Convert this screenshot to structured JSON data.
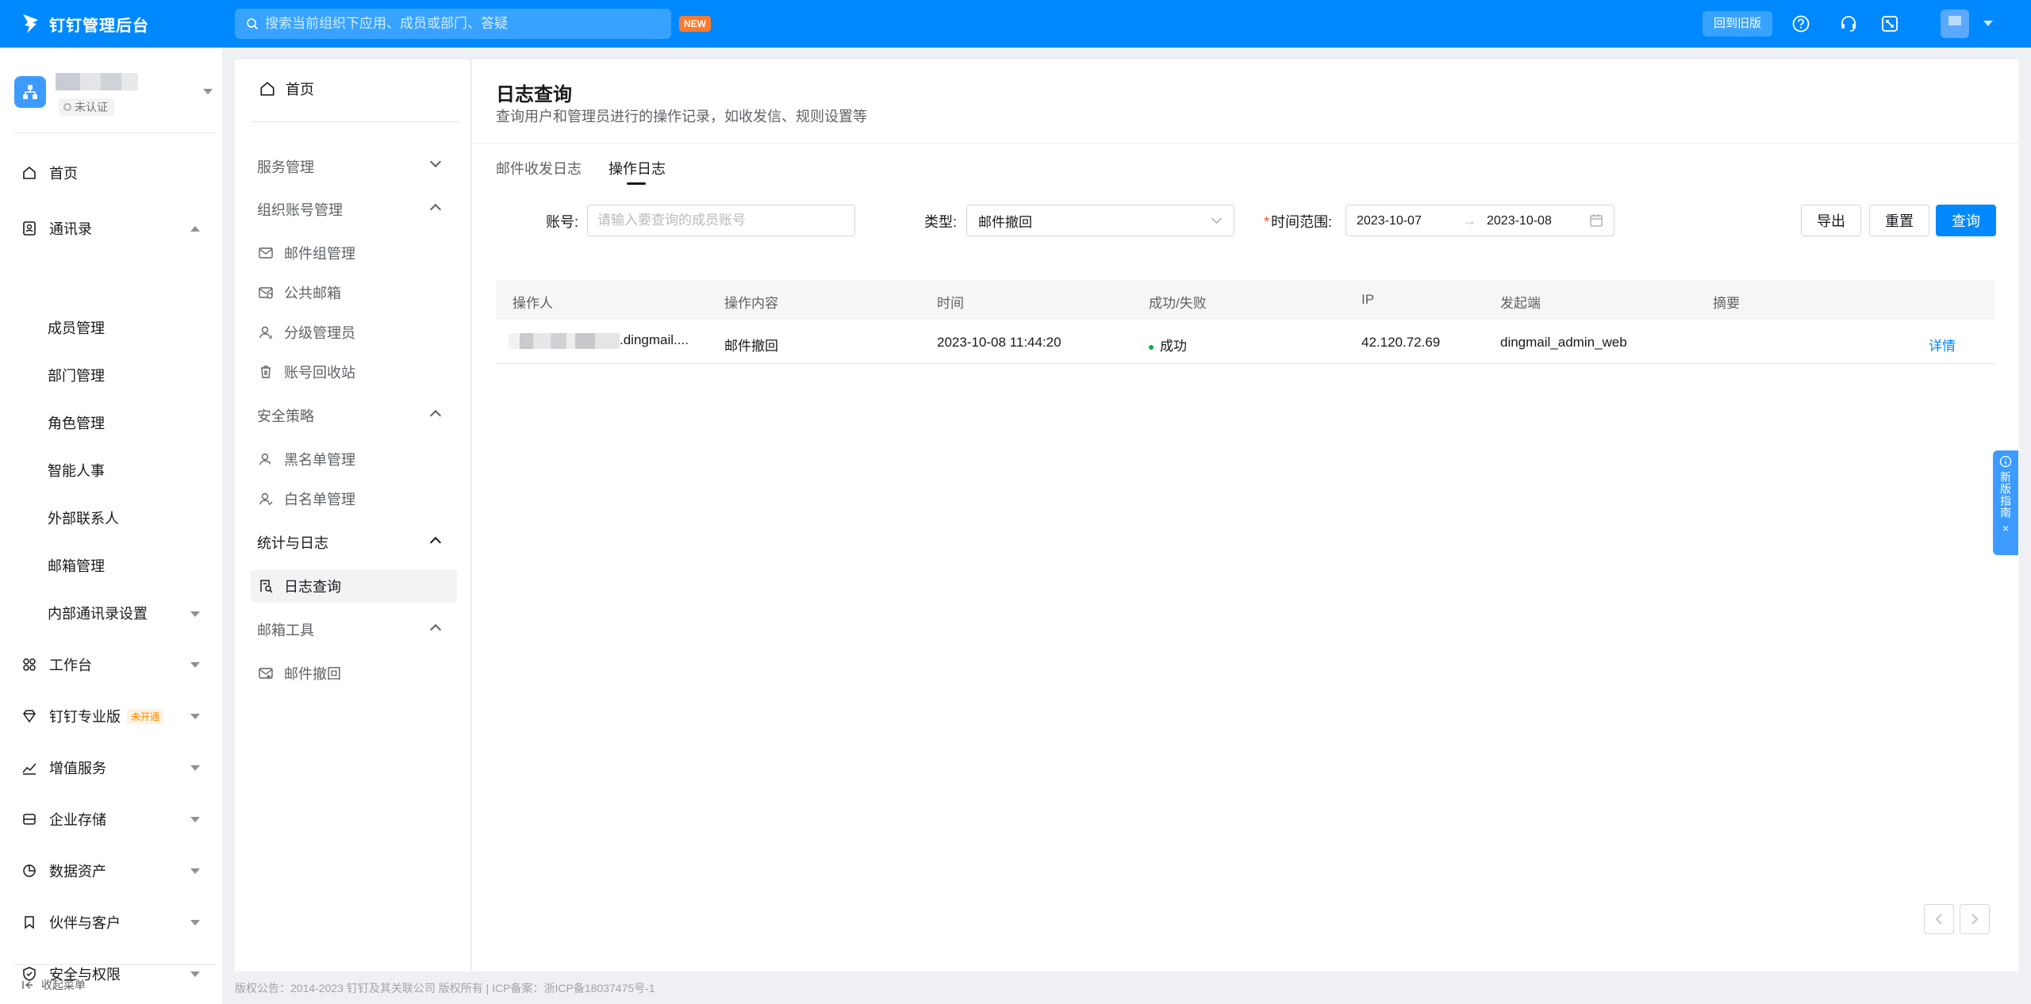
{
  "topbar": {
    "brand": "钉钉管理后台",
    "search_placeholder": "搜索当前组织下应用、成员或部门、答疑",
    "new_badge": "NEW",
    "back_old": "回到旧版"
  },
  "org": {
    "status": "未认证"
  },
  "leftnav": {
    "home": "首页",
    "contacts": "通讯录",
    "contacts_children": [
      "成员管理",
      "部门管理",
      "角色管理",
      "智能人事",
      "外部联系人",
      "邮箱管理",
      "内部通讯录设置"
    ],
    "workbench": "工作台",
    "pro": "钉钉专业版",
    "pro_tag": "未开通",
    "value_added": "增值服务",
    "storage": "企业存储",
    "data_assets": "数据资产",
    "partners": "伙伴与客户",
    "security": "安全与权限",
    "collapse": "收起菜单"
  },
  "submenu": {
    "home": "首页",
    "service_mgmt": "服务管理",
    "org_account_mgmt": "组织账号管理",
    "mail_group_mgmt": "邮件组管理",
    "public_mailbox": "公共邮箱",
    "sub_admin": "分级管理员",
    "account_recycle": "账号回收站",
    "security_policy": "安全策略",
    "blacklist": "黑名单管理",
    "whitelist": "白名单管理",
    "stats_logs": "统计与日志",
    "log_query": "日志查询",
    "mail_tools": "邮箱工具",
    "mail_recall": "邮件撤回"
  },
  "main": {
    "title": "日志查询",
    "subtitle": "查询用户和管理员进行的操作记录，如收发信、规则设置等",
    "tabs": [
      "邮件收发日志",
      "操作日志"
    ],
    "filters": {
      "account_label": "账号:",
      "account_placeholder": "请输入要查询的成员账号",
      "type_label": "类型:",
      "type_value": "邮件撤回",
      "range_required": "*",
      "range_label": "时间范围:",
      "start_date": "2023-10-07",
      "range_arrow": "→",
      "end_date": "2023-10-08"
    },
    "buttons": {
      "export": "导出",
      "reset": "重置",
      "query": "查询"
    },
    "table": {
      "columns": [
        "操作人",
        "操作内容",
        "时间",
        "成功/失败",
        "IP",
        "发起端",
        "摘要"
      ],
      "rows": [
        {
          "operator_suffix": ".dingmail....",
          "content": "邮件撤回",
          "time": "2023-10-08 11:44:20",
          "status": "成功",
          "ip": "42.120.72.69",
          "client": "dingmail_admin_web",
          "summary": "",
          "action": "详情"
        }
      ]
    }
  },
  "guide": {
    "text": "新版指南",
    "close": "×"
  },
  "footer": "版权公告：2014-2023 钉钉及其关联公司 版权所有 | ICP备案：浙ICP备18037475号-1",
  "colors": {
    "brand": "#0089ff",
    "success": "#00b042",
    "required": "#ff5219",
    "pro_tag": "#ff8a00"
  }
}
